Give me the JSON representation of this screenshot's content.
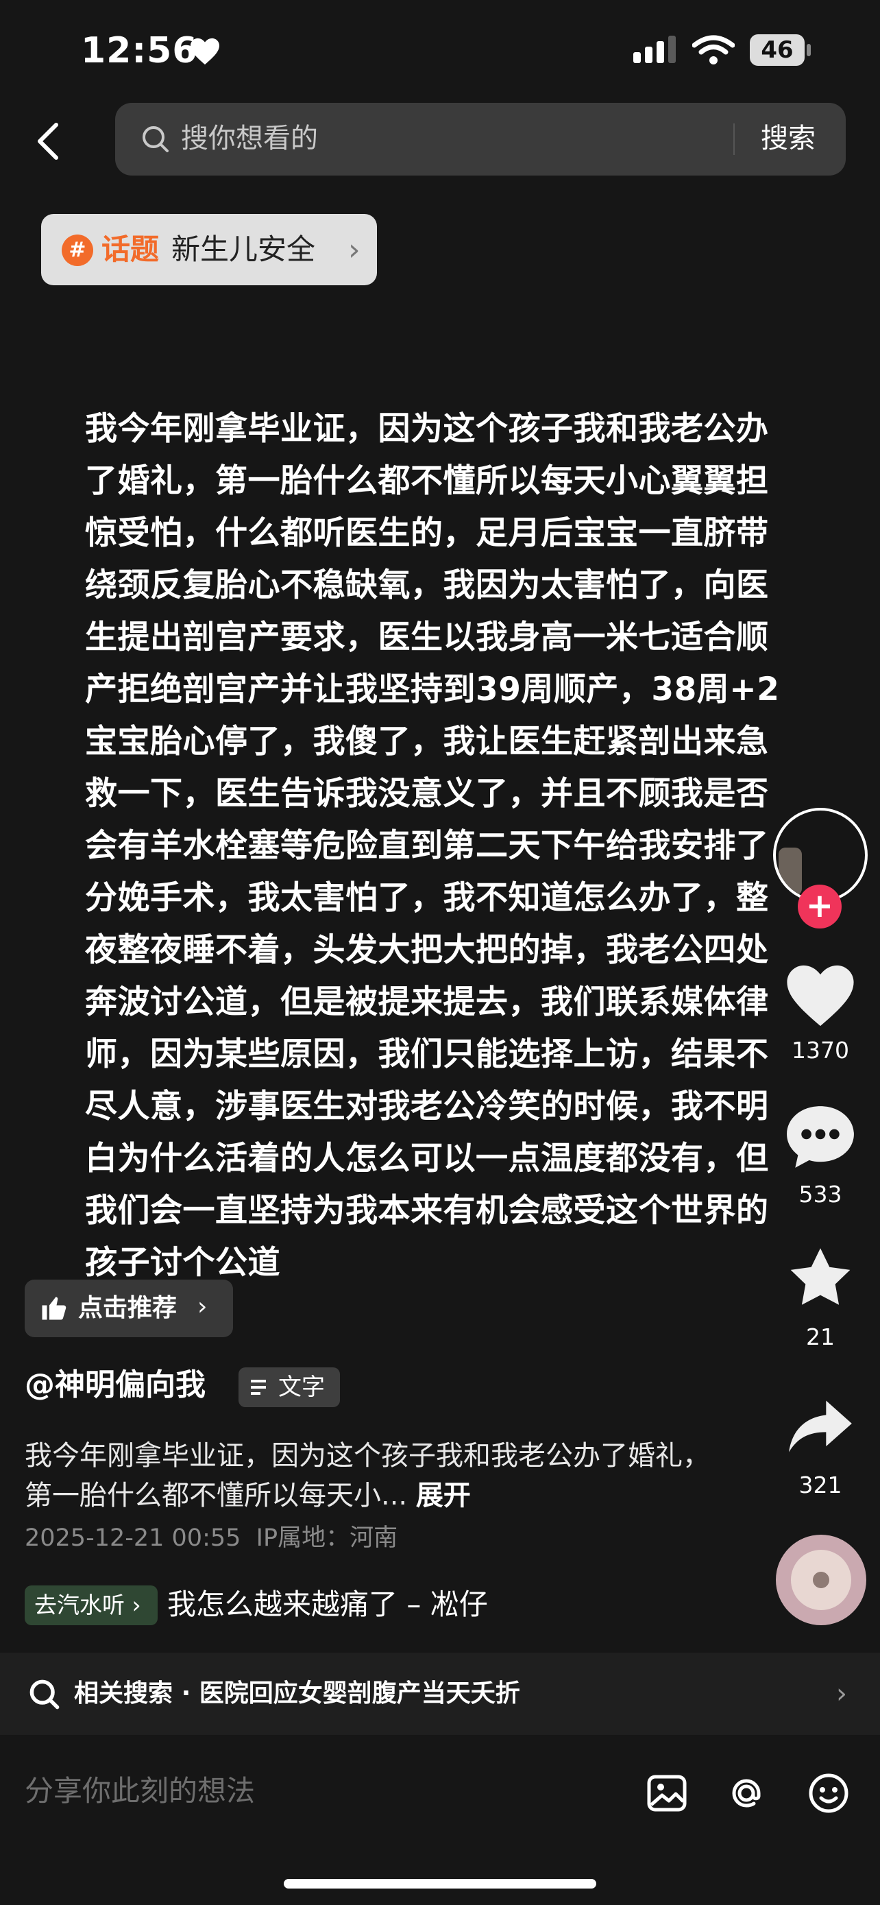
{
  "status_bar": {
    "time": "12:56",
    "battery": "46"
  },
  "search": {
    "placeholder": "搜你想看的",
    "button": "搜索"
  },
  "topic": {
    "label": "话题",
    "name": "新生儿安全"
  },
  "post": {
    "main_text": "我今年刚拿毕业证，因为这个孩子我和我老公办了婚礼，第一胎什么都不懂所以每天小心翼翼担惊受怕，什么都听医生的，足月后宝宝一直脐带绕颈反复胎心不稳缺氧，我因为太害怕了，向医生提出剖宫产要求，医生以我身高一米七适合顺产拒绝剖宫产并让我坚持到39周顺产，38周+2宝宝胎心停了，我傻了，我让医生赶紧剖出来急救一下，医生告诉我没意义了，并且不顾我是否会有羊水栓塞等危险直到第二天下午给我安排了分娩手术，我太害怕了，我不知道怎么办了，整夜整夜睡不着，头发大把大把的掉，我老公四处奔波讨公道，但是被提来提去，我们联系媒体律师，因为某些原因，我们只能选择上访，结果不尽人意，涉事医生对我老公冷笑的时候，我不明白为什么活着的人怎么可以一点温度都没有，但我们会一直坚持为我本来有机会感受这个世界的孩子讨个公道",
    "recommend": "点击推荐",
    "author": "@神明偏向我",
    "type_badge": "文字",
    "desc": "我今年刚拿毕业证，因为这个孩子我和我老公办了婚礼，第一胎什么都不懂所以每天小...",
    "expand": "展开",
    "date": "2025-12-21 00:55",
    "ip": "IP属地：河南",
    "music_chip": "去汽水听",
    "song": "我怎么越来越痛了 – 凇仔"
  },
  "actions": {
    "likes": "1370",
    "comments": "533",
    "favorites": "21",
    "shares": "321"
  },
  "related": {
    "label": "相关搜索",
    "sep": "·",
    "query": "医院回应女婴剖腹产当天夭折"
  },
  "comment_bar": {
    "placeholder": "分享你此刻的想法"
  }
}
